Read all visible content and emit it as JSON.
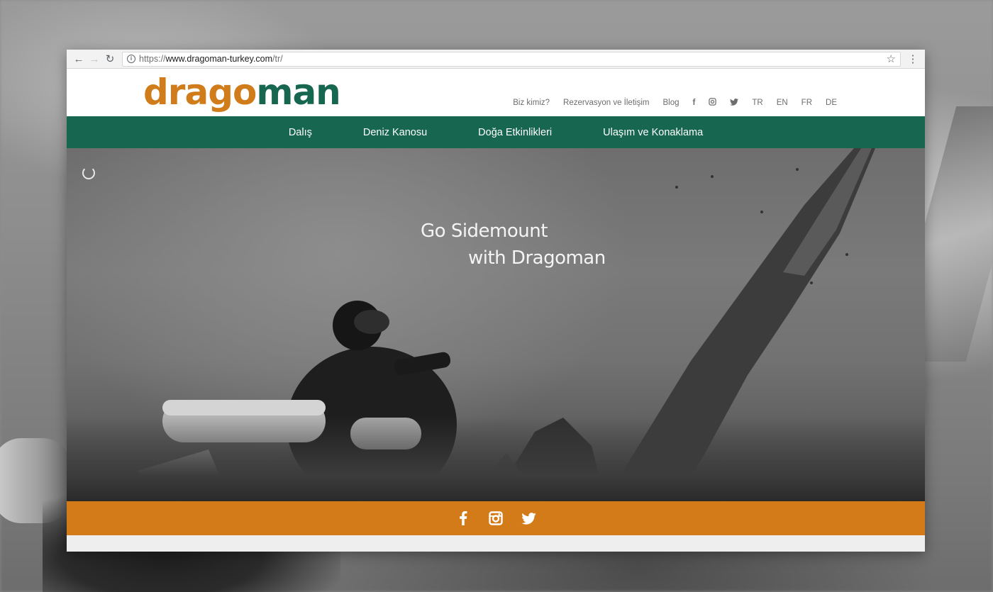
{
  "browser": {
    "url": {
      "scheme": "https://",
      "host": "www.dragoman-turkey.com",
      "path": "/tr/"
    }
  },
  "header": {
    "logo": {
      "part1": "drago",
      "part2": "man"
    },
    "top_links": [
      {
        "label": "Biz kimiz?"
      },
      {
        "label": "Rezervasyon ve İletişim"
      },
      {
        "label": "Blog"
      }
    ],
    "languages": [
      "TR",
      "EN",
      "FR",
      "DE"
    ]
  },
  "main_nav": [
    {
      "label": "Dalış"
    },
    {
      "label": "Deniz Kanosu"
    },
    {
      "label": "Doğa Etkinlikleri"
    },
    {
      "label": "Ulaşım ve Konaklama"
    }
  ],
  "hero": {
    "line1": "Go Sidemount",
    "line2": "with Dragoman"
  },
  "colors": {
    "brand_green": "#17664f",
    "brand_orange": "#d27b18"
  }
}
